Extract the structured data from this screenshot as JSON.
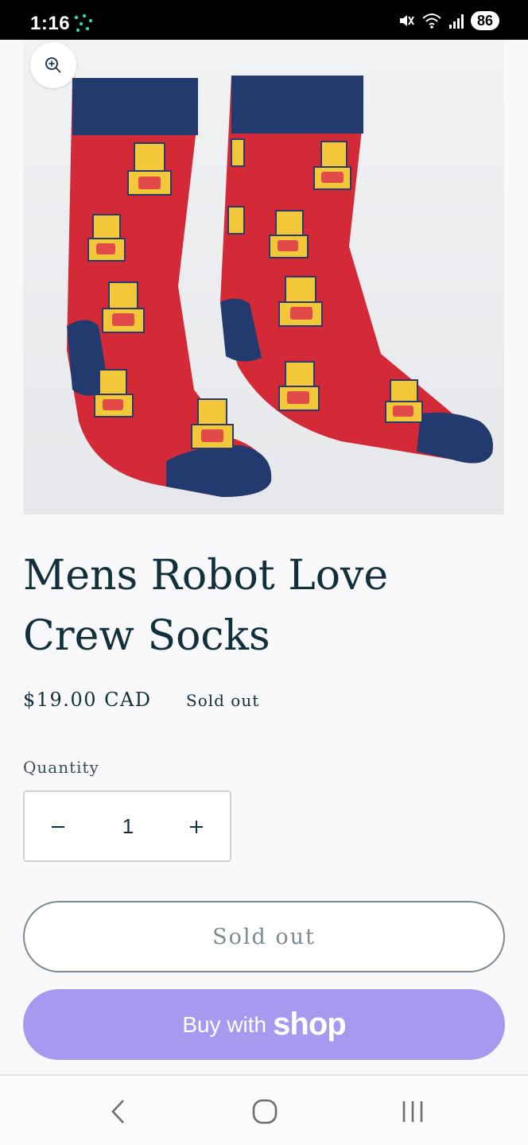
{
  "status_bar": {
    "time": "1:16",
    "battery": "86",
    "icons": [
      "mute-icon",
      "wifi-icon",
      "signal-icon"
    ]
  },
  "product": {
    "title": "Mens Robot Love Crew Socks",
    "price": "$19.00 CAD",
    "badge": "Sold out",
    "image_alt": "red socks with robot pattern",
    "colors": {
      "sock": "#d42a37",
      "cuff": "#233a6e",
      "background": "#eef0f2"
    }
  },
  "quantity": {
    "label": "Quantity",
    "value": "1",
    "minus_icon": "minus-icon",
    "plus_icon": "plus-icon"
  },
  "buttons": {
    "sold_out": "Sold out",
    "buy_prefix": "Buy with",
    "buy_brand": "shop"
  },
  "nav": {
    "back": "back-icon",
    "home": "home-icon",
    "recents": "recents-icon"
  }
}
